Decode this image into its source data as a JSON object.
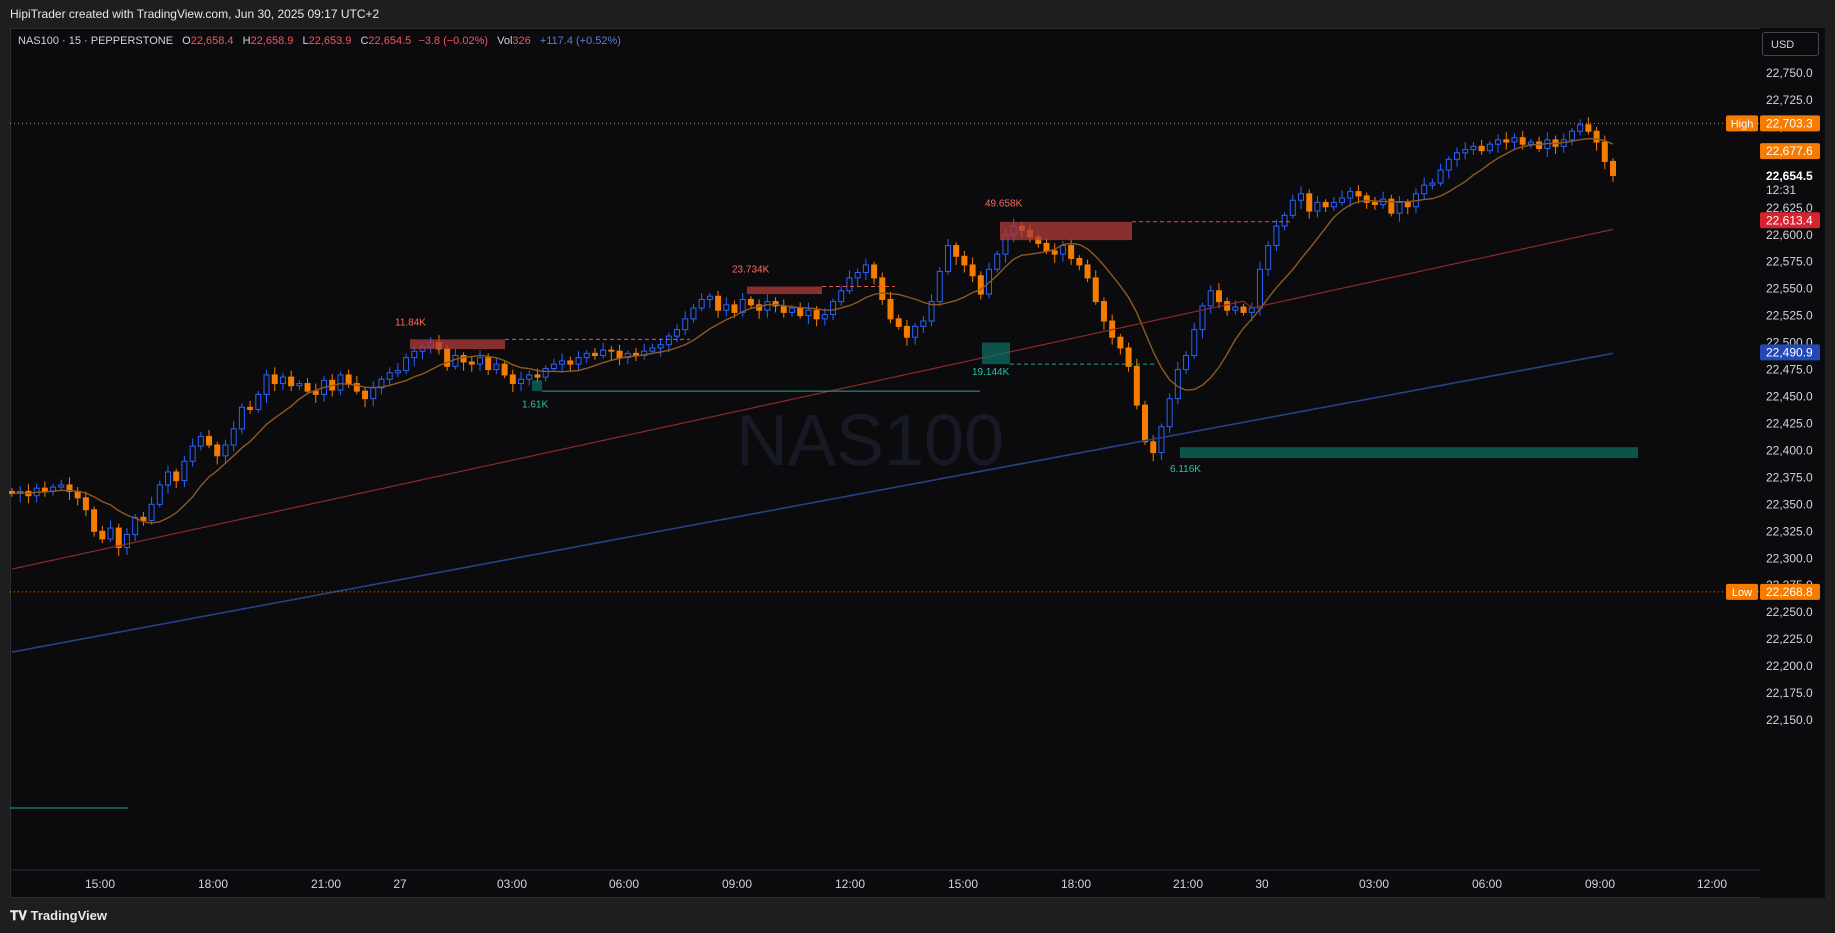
{
  "header": {
    "title": "HipiTrader created with TradingView.com, Jun 30, 2025 09:17 UTC+2"
  },
  "legend": {
    "symbol": "NAS100 · 15 · PEPPERSTONE",
    "o_label": "O",
    "o": "22,658.4",
    "h_label": "H",
    "h": "22,658.9",
    "l_label": "L",
    "l": "22,653.9",
    "c_label": "C",
    "c": "22,654.5",
    "change": "−3.8 (−0.02%)",
    "vol_label": "Vol",
    "vol": "326",
    "vol_change": "+117.4 (+0.52%)"
  },
  "currency_button": "USD",
  "watermark": "NAS100",
  "footer": {
    "brand": "TradingView"
  },
  "colors": {
    "up": "#2962ff",
    "down": "#f57c00",
    "ma_fast": "#8d5b1f",
    "ma_mid": "#8b2a2a",
    "ma_slow": "#283f8a",
    "supply": "#b23b3b",
    "demand": "#0d6e60",
    "high_low": "#f57c00"
  },
  "chart_data": {
    "type": "candlestick",
    "y_range": [
      22125,
      22775
    ],
    "y_ticks": [
      "22,750.0",
      "22,725.0",
      "22,700.0",
      "22,675.0",
      "22,650.0",
      "22,625.0",
      "22,600.0",
      "22,575.0",
      "22,550.0",
      "22,525.0",
      "22,500.0",
      "22,475.0",
      "22,450.0",
      "22,425.0",
      "22,400.0",
      "22,375.0",
      "22,350.0",
      "22,325.0",
      "22,300.0",
      "22,275.0",
      "22,250.0",
      "22,225.0",
      "22,200.0",
      "22,175.0",
      "22,150.0"
    ],
    "x_ticks": [
      "15:00",
      "18:00",
      "21:00",
      "27",
      "03:00",
      "06:00",
      "09:00",
      "12:00",
      "15:00",
      "18:00",
      "21:00",
      "30",
      "03:00",
      "06:00",
      "09:00",
      "12:00"
    ],
    "price_labels": [
      {
        "tag": "High",
        "value": "22,703.3",
        "level": 22703.3,
        "color": "#f57c00"
      },
      {
        "tag": "",
        "value": "22,677.6",
        "level": 22677.6,
        "color": "#f57c00"
      },
      {
        "tag": "",
        "value": "22,654.5",
        "level": 22654.5,
        "color": "#0b0b0e",
        "countdown": "12:31"
      },
      {
        "tag": "",
        "value": "22,613.4",
        "level": 22613.4,
        "color": "#d6232f"
      },
      {
        "tag": "",
        "value": "22,490.9",
        "level": 22490.9,
        "color": "#2448b8"
      },
      {
        "tag": "Low",
        "value": "22,268.8",
        "level": 22268.8,
        "color": "#f57c00"
      }
    ],
    "annotations": [
      {
        "text": "11.84K",
        "kind": "supply"
      },
      {
        "text": "23.734K",
        "kind": "supply"
      },
      {
        "text": "49.658K",
        "kind": "supply"
      },
      {
        "text": "1.61K",
        "kind": "demand"
      },
      {
        "text": "19.144K",
        "kind": "demand"
      },
      {
        "text": "6.116K",
        "kind": "demand"
      }
    ],
    "closes": [
      22360,
      22362,
      22358,
      22365,
      22362,
      22366,
      22368,
      22362,
      22356,
      22345,
      22325,
      22318,
      22328,
      22310,
      22322,
      22338,
      22335,
      22350,
      22368,
      22380,
      22372,
      22390,
      22404,
      22413,
      22405,
      22395,
      22405,
      22420,
      22440,
      22438,
      22452,
      22470,
      22462,
      22468,
      22460,
      22462,
      22455,
      22452,
      22465,
      22456,
      22470,
      22462,
      22455,
      22448,
      22458,
      22466,
      22472,
      22474,
      22486,
      22492,
      22496,
      22500,
      22494,
      22478,
      22488,
      22482,
      22480,
      22486,
      22475,
      22480,
      22470,
      22462,
      22466,
      22470,
      22468,
      22476,
      22480,
      22483,
      22480,
      22486,
      22490,
      22488,
      22493,
      22492,
      22486,
      22490,
      22488,
      22492,
      22495,
      22498,
      22506,
      22512,
      22522,
      22532,
      22540,
      22543,
      22530,
      22535,
      22528,
      22540,
      22535,
      22530,
      22538,
      22534,
      22528,
      22532,
      22525,
      22530,
      22522,
      22526,
      22538,
      22548,
      22560,
      22565,
      22572,
      22560,
      22540,
      22522,
      22515,
      22505,
      22515,
      22520,
      22538,
      22566,
      22590,
      22580,
      22572,
      22562,
      22545,
      22568,
      22582,
      22600,
      22608,
      22604,
      22598,
      22592,
      22585,
      22582,
      22590,
      22578,
      22572,
      22560,
      22538,
      22520,
      22505,
      22495,
      22478,
      22442,
      22408,
      22398,
      22422,
      22448,
      22475,
      22488,
      22512,
      22534,
      22548,
      22538,
      22530,
      22533,
      22528,
      22532,
      22568,
      22590,
      22608,
      22618,
      22632,
      22638,
      22622,
      22630,
      22626,
      22630,
      22634,
      22640,
      22636,
      22630,
      22628,
      22633,
      22620,
      22630,
      22626,
      22638,
      22646,
      22648,
      22660,
      22670,
      22676,
      22679,
      22682,
      22678,
      22684,
      22688,
      22686,
      22690,
      22684,
      22686,
      22680,
      22688,
      22682,
      22688,
      22696,
      22702,
      22696,
      22686,
      22668,
      22655
    ]
  }
}
